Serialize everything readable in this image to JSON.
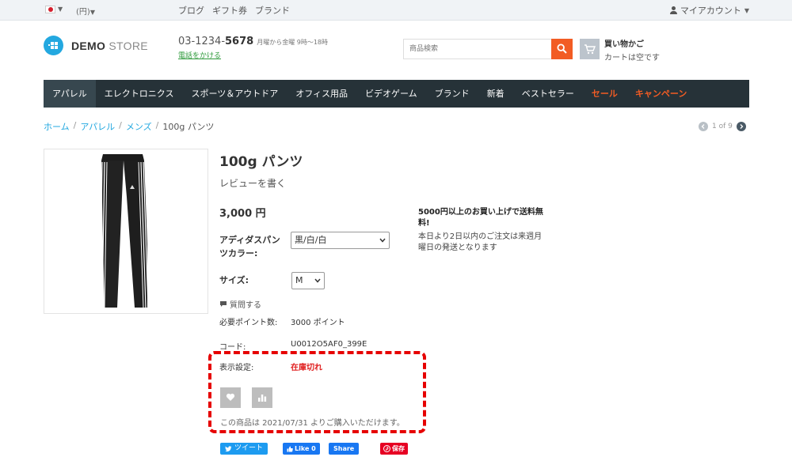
{
  "topbar": {
    "currency": "(円)",
    "links": [
      "ブログ",
      "ギフト券",
      "ブランド"
    ],
    "account": "マイアカウント"
  },
  "header": {
    "logo_bold": "DEMO",
    "logo_light": " STORE",
    "phone_prefix": "03-1234-",
    "phone_suffix": "5678",
    "hours": "月曜から金曜 9時〜18時",
    "call_link": "電話をかける",
    "search_placeholder": "商品検索",
    "cart_title": "買い物かご",
    "cart_status": "カートは空です"
  },
  "nav": {
    "items": [
      {
        "label": "アパレル"
      },
      {
        "label": "エレクトロニクス"
      },
      {
        "label": "スポーツ＆アウトドア"
      },
      {
        "label": "オフィス用品"
      },
      {
        "label": "ビデオゲーム"
      },
      {
        "label": "ブランド"
      },
      {
        "label": "新着"
      },
      {
        "label": "ベストセラー"
      },
      {
        "label": "セール"
      },
      {
        "label": "キャンペーン"
      }
    ]
  },
  "breadcrumb": {
    "items": [
      "ホーム",
      "アパレル",
      "メンズ"
    ],
    "separator": "/",
    "current": "100g パンツ",
    "pager": "1 of 9"
  },
  "product": {
    "title": "100g パンツ",
    "review_link": "レビューを書く",
    "price": "3,000 円",
    "color_label": "アディダスパンツカラー:",
    "color_value": "黒/白/白",
    "size_label": "サイズ:",
    "size_value": "M",
    "question_link": "質問する",
    "points_label": "必要ポイント数:",
    "points_value": "3000 ポイント",
    "code_label": "コード:",
    "code_value": "U0012O5AF0_399E",
    "stock_label": "表示設定:",
    "stock_value": "在庫切れ",
    "availability": "この商品は 2021/07/31 よりご購入いただけます。",
    "shipping_title": "5000円以上のお買い上げで送料無料!",
    "shipping_text": "本日より2日以内のご注文は来週月曜日の発送となります"
  },
  "social": {
    "tweet": "ツイート",
    "like": "Like 0",
    "share": "Share",
    "pin": "保存"
  },
  "colors": {
    "accent": "#f25c24",
    "brand": "#23a8e0",
    "nav_bg": "#263238",
    "out_of_stock": "#e02020",
    "highlight": "#e60000"
  }
}
